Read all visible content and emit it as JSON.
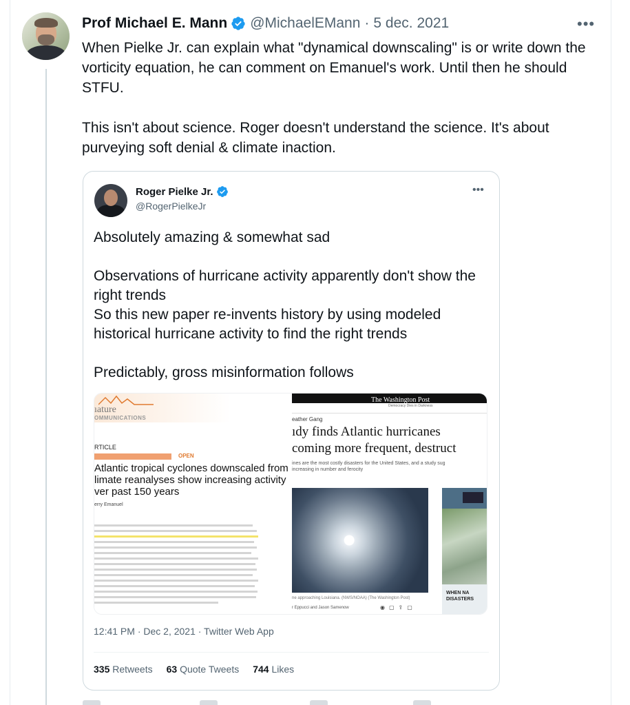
{
  "tweet": {
    "author_name": "Prof Michael E. Mann",
    "handle": "@MichaelEMann",
    "separator": "·",
    "date": "5 dec. 2021",
    "more_icon": "ellipsis-icon",
    "paragraphs": [
      "When Pielke Jr. can explain what \"dynamical downscaling\" is or write down the vorticity equation, he can comment on Emanuel's work. Until then he should STFU.",
      "This isn't about science. Roger doesn't understand the science. It's about purveying soft denial & climate inaction."
    ]
  },
  "quote": {
    "author_name": "Roger Pielke Jr.",
    "handle": "@RogerPielkeJr",
    "paragraphs": [
      "Absolutely amazing & somewhat sad",
      "Observations of hurricane activity apparently don't show the right trends\nSo this new paper re-invents history by using modeled historical hurricane activity to find the right trends",
      "Predictably, gross misinformation follows"
    ],
    "paper": {
      "journal": "ıature",
      "journal_sub": "OMMUNICATIONS",
      "article_label": "RTICLE",
      "open_label": "OPEN",
      "title_lines": [
        "Atlantic tropical cyclones downscaled from",
        "limate reanalyses show increasing activity",
        "ver past 150 years"
      ],
      "author": "erry Emanuel"
    },
    "article": {
      "masthead": "The Washington Post",
      "masthead_sub": "Democracy Dies in Darkness",
      "category": "eather Gang",
      "headline_lines": [
        "ıdy finds Atlantic hurricanes",
        "coming more frequent, destruct"
      ],
      "dek_lines": [
        "ines are the most costly disasters for the United States, and a study sug",
        "increasing in number and ferocity"
      ],
      "caption": "ne approaching Louisiana. (NWS/NOAA) (The Washington Post)",
      "byline": "r Eppucci and Jason Samenow",
      "side_label_lines": [
        "WHEN NA",
        "DISASTERS"
      ]
    },
    "timestamp": "12:41 PM · Dec 2, 2021 · Twitter Web App",
    "stats": {
      "retweets_count": "335",
      "retweets_label": "Retweets",
      "quotes_count": "63",
      "quotes_label": "Quote Tweets",
      "likes_count": "744",
      "likes_label": "Likes"
    }
  },
  "colors": {
    "verified_blue": "#1d9bf0",
    "secondary_text": "#536471",
    "border": "#cfd9de"
  }
}
